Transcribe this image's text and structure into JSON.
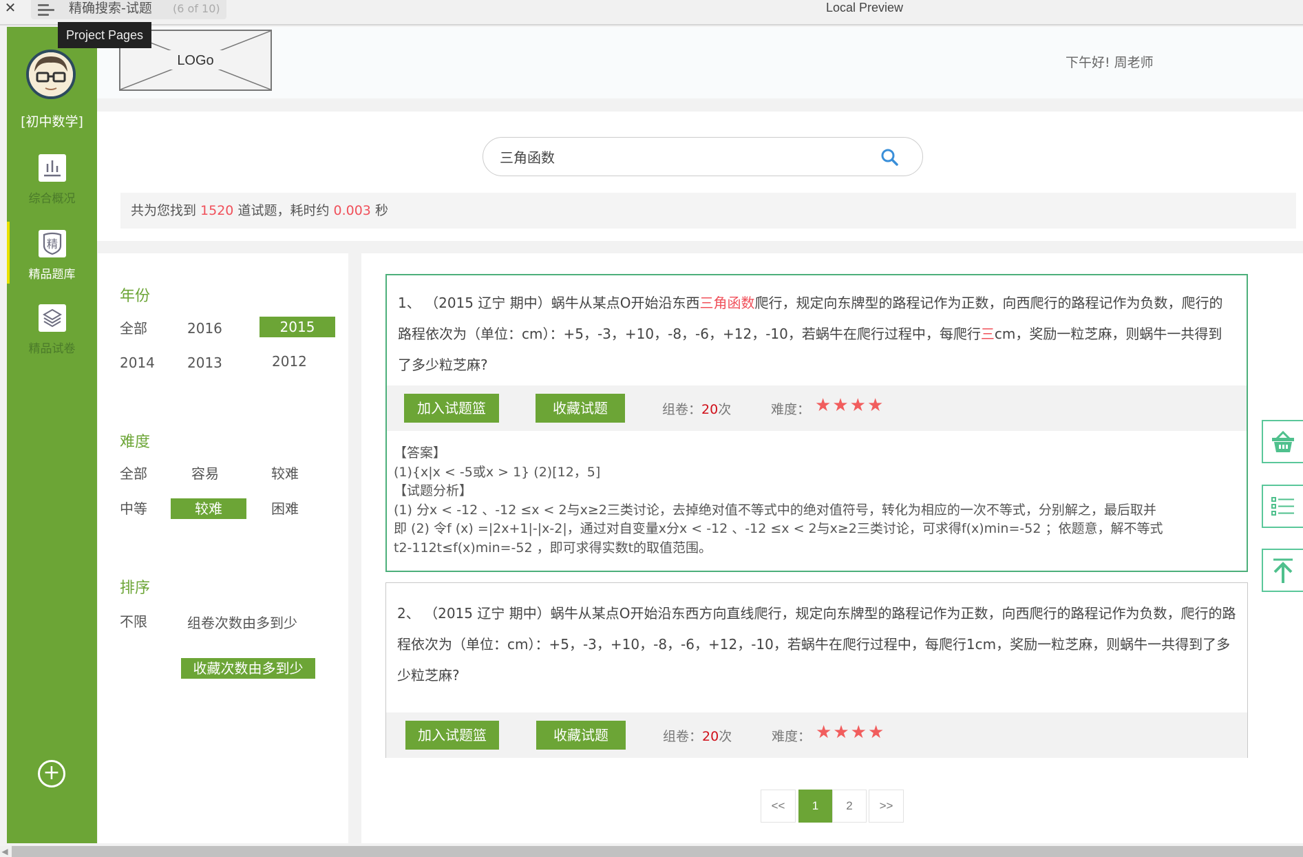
{
  "titlebar": {
    "close_glyph": "✕",
    "page_name": "精确搜索-试题",
    "page_count": "(6 of 10)",
    "window_title": "Local Preview",
    "tooltip": "Project Pages"
  },
  "sidebar": {
    "subject": "[初中数学]",
    "items": [
      {
        "label": "综合概况",
        "icon": "bar-chart-icon",
        "active": false
      },
      {
        "label": "精品题库",
        "icon": "badge-jing-icon",
        "icon_text": "精",
        "active": true
      },
      {
        "label": "精品试卷",
        "icon": "layers-icon",
        "active": false
      }
    ],
    "add_glyph": "+"
  },
  "header": {
    "logo_text": "LOGo",
    "greeting": "下午好! 周老师"
  },
  "search": {
    "value": "三角函数",
    "results_prefix": "共为您找到 ",
    "results_count": "1520",
    "results_mid": " 道试题，耗时约 ",
    "results_time": "0.003",
    "results_suffix": " 秒"
  },
  "filters": {
    "year": {
      "title": "年份",
      "options": [
        "全部",
        "2016",
        "2015",
        "2014",
        "2013",
        "2012"
      ],
      "selected": "2015"
    },
    "difficulty": {
      "title": "难度",
      "options": [
        "全部",
        "容易",
        "较难",
        "中等",
        "较难",
        "困难"
      ],
      "selected_index": 4
    },
    "sort": {
      "title": "排序",
      "options": [
        "不限",
        "组卷次数由多到少",
        "收藏次数由多到少"
      ],
      "selected": "收藏次数由多到少"
    }
  },
  "questions": [
    {
      "number": "1、",
      "text_before": "（2015 辽宁 期中）蜗牛从某点O开始沿东西",
      "highlight": "三角函数",
      "text_mid": "爬行，规定向东牌型的路程记作为正数，向西爬行的路程记作为负数，爬行的路程依次为（单位：cm）：+5，-3，+10，-8，-6，+12，-10，若蜗牛在爬行过程中，每爬行",
      "highlight2": "三",
      "text_after": "cm，奖励一粒芝麻，则蜗牛一共得到了多少粒芝麻?",
      "add_label": "加入试题篮",
      "fav_label": "收藏试题",
      "usage_label": "组卷：",
      "usage_count": "20",
      "usage_unit": "次",
      "difficulty_label": "难度：",
      "difficulty_stars": 4,
      "answer_title": "【答案】",
      "answer": "(1){x|x < -5或x > 1} (2)[12，5]",
      "analysis_title": "【试题分析】",
      "analysis": [
        "(1) 分x < -12 、-12 ≤x < 2与x≥2三类讨论，去掉绝对值不等式中的绝对值符号，转化为相应的一次不等式，分别解之，最后取并",
        "即 (2) 令f (x) =|2x+1|-|x-2|，通过对自变量x分x < -12 、-12 ≤x < 2与x≥2三类讨论，可求得f(x)min=-52 ；依题意，解不等式",
        "t2-112t≤f(x)min=-52 ，即可求得实数t的取值范围。"
      ]
    },
    {
      "number": "2、",
      "text": "（2015 辽宁 期中）蜗牛从某点O开始沿东西方向直线爬行，规定向东牌型的路程记作为正数，向西爬行的路程记作为负数，爬行的路程依次为（单位：cm）：+5，-3，+10，-8，-6，+12，-10，若蜗牛在爬行过程中，每爬行1cm，奖励一粒芝麻，则蜗牛一共得到了多少粒芝麻?",
      "add_label": "加入试题篮",
      "fav_label": "收藏试题",
      "usage_label": "组卷：",
      "usage_count": "20",
      "usage_unit": "次",
      "difficulty_label": "难度：",
      "difficulty_stars": 4
    }
  ],
  "pagination": {
    "prev": "<<",
    "pages": [
      "1",
      "2"
    ],
    "current": "1",
    "next": ">>"
  },
  "float_buttons": [
    "basket-icon",
    "list-icon",
    "back-to-top-icon"
  ],
  "colors": {
    "brand_green": "#6ca536",
    "highlight_red": "#f0505a",
    "count_red": "#d0101a",
    "star_red": "#f15d5d",
    "float_teal": "#5ac79a",
    "active_indicator": "#e8e100"
  }
}
